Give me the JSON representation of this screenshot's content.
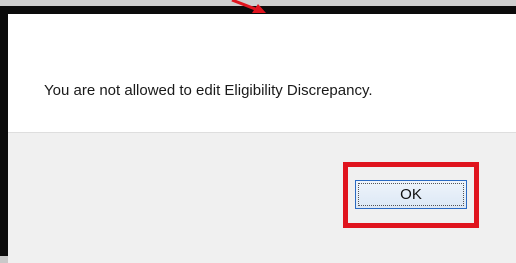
{
  "dialog": {
    "message": "You are not allowed to edit Eligibility Discrepancy.",
    "ok_label": "OK"
  },
  "annotation": {
    "highlight_color": "#e0141e",
    "arrow_color": "#e0141e"
  }
}
